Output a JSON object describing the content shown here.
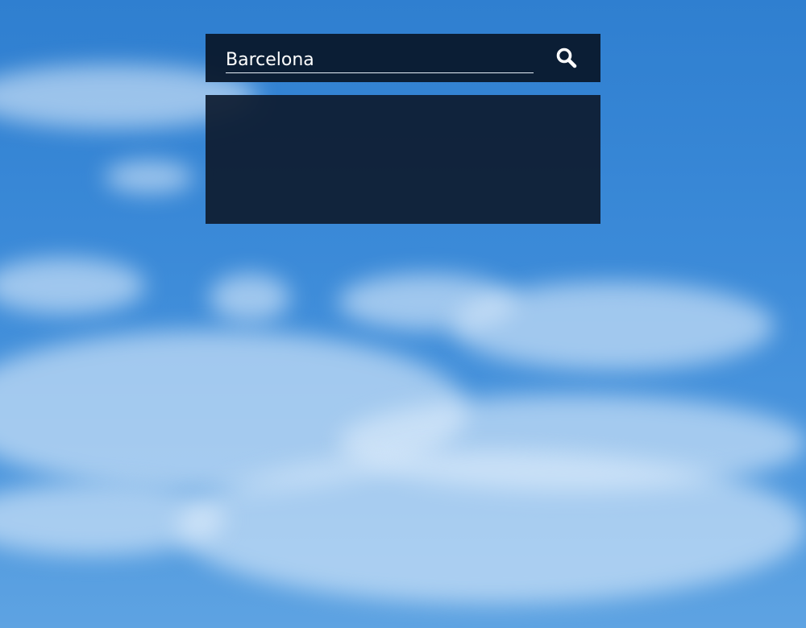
{
  "search": {
    "value": "Barcelona",
    "button_icon": "search-icon"
  },
  "results": {
    "items": []
  },
  "colors": {
    "sky": "#3b8ad8",
    "panel": "#0e1c30",
    "text": "#ffffff"
  }
}
